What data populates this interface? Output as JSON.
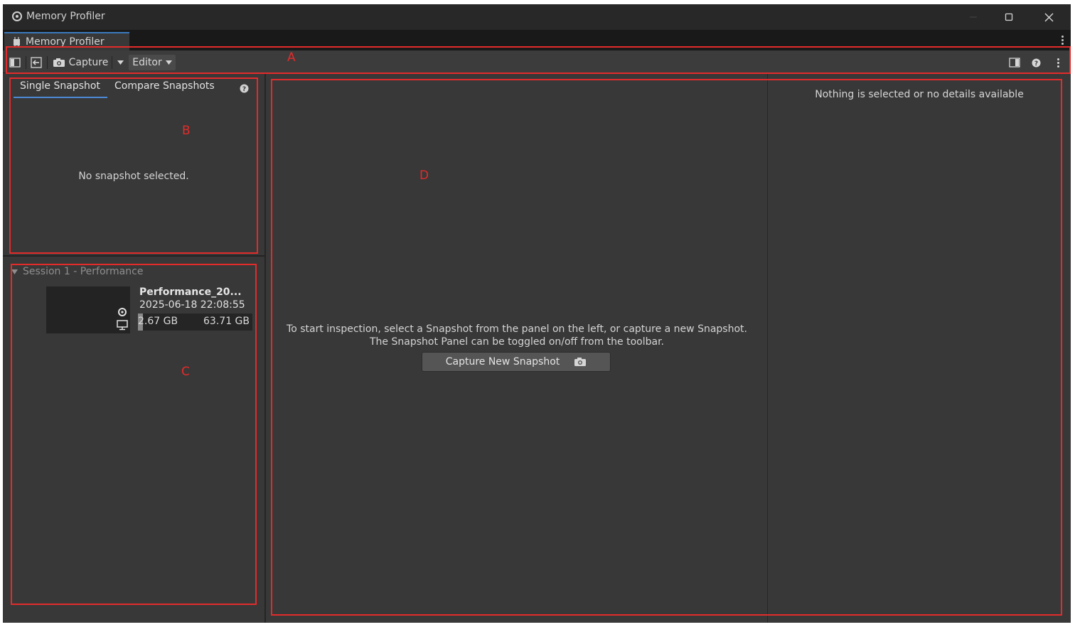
{
  "window": {
    "title": "Memory Profiler"
  },
  "tab": {
    "label": "Memory Profiler"
  },
  "toolbar": {
    "capture_label": "Capture",
    "target_label": "Editor"
  },
  "left_panel": {
    "tabs": [
      "Single Snapshot",
      "Compare Snapshots"
    ],
    "empty_message": "No snapshot selected."
  },
  "session": {
    "title": "Session 1 - Performance",
    "snapshot": {
      "name": "Performance_20...",
      "date": "2025-06-18 22:08:55",
      "used": "2.67 GB",
      "total": "63.71 GB",
      "used_fraction": 0.042
    }
  },
  "main": {
    "message_line1": "To start inspection, select a Snapshot from the panel on the left, or capture a new Snapshot.",
    "message_line2": "The Snapshot Panel can be toggled on/off from the toolbar.",
    "capture_button": "Capture New Snapshot"
  },
  "details": {
    "empty_message": "Nothing is selected or no details available"
  },
  "annotations": {
    "a": "A",
    "b": "B",
    "c": "C",
    "d": "D"
  },
  "colors": {
    "annotation": "#e32b2b",
    "accent": "#4c8bd6",
    "background": "#383838"
  }
}
